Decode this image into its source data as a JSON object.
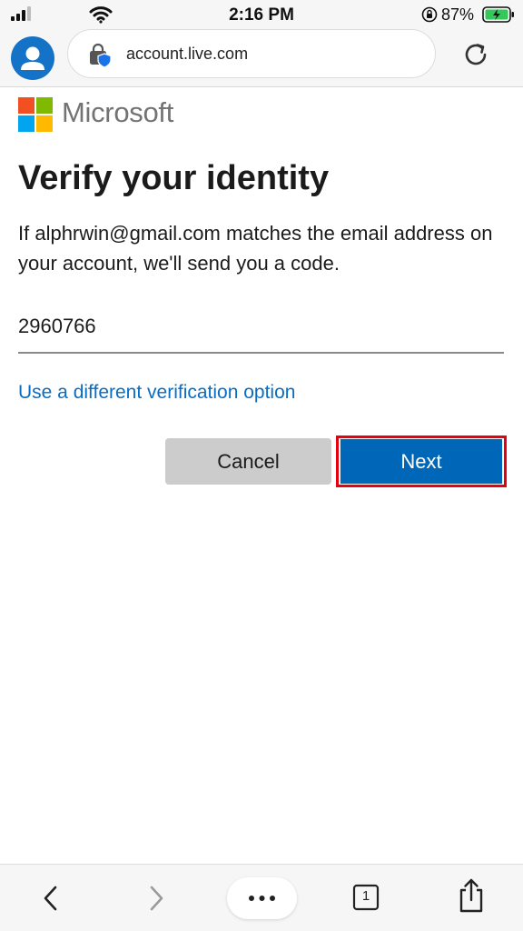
{
  "status_bar": {
    "time": "2:16 PM",
    "battery_percent": "87%",
    "icons": [
      "signal-icon",
      "wifi-icon",
      "orientation-lock-icon",
      "battery-charging-icon"
    ]
  },
  "browser": {
    "url": "account.live.com",
    "icons": [
      "profile-icon",
      "site-lock-icon",
      "reload-icon"
    ]
  },
  "page": {
    "brand": "Microsoft",
    "title": "Verify your identity",
    "description": "If alphrwin@gmail.com matches the email address on your account, we'll send you a code.",
    "code_value": "2960766",
    "alt_link": "Use a different verification option",
    "cancel_label": "Cancel",
    "next_label": "Next",
    "colors": {
      "primary": "#0067b8",
      "link": "#0a6dc2",
      "highlight": "#e60014",
      "logo_red": "#f25022",
      "logo_green": "#7fba00",
      "logo_blue": "#00a4ef",
      "logo_yellow": "#ffb900"
    }
  },
  "toolbar": {
    "tab_count": "1",
    "icons": [
      "back-icon",
      "forward-icon",
      "more-icon",
      "tabs-icon",
      "share-icon"
    ]
  }
}
